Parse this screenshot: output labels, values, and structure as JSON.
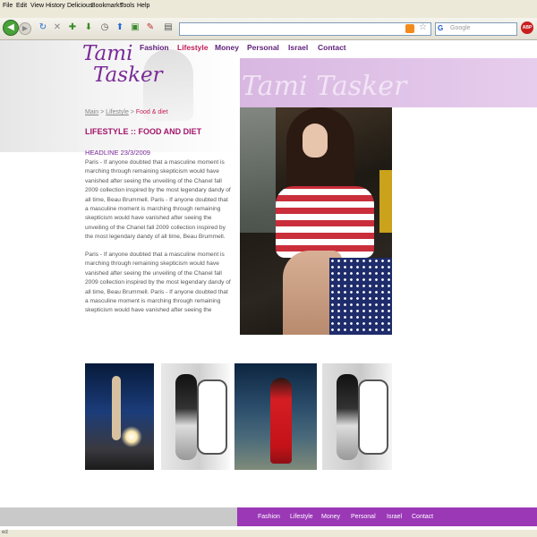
{
  "browser": {
    "menu": [
      "File",
      "Edit",
      "View",
      "History",
      "Delicious",
      "Bookmarks",
      "Tools",
      "Help"
    ],
    "search_placeholder": "Google",
    "adblock_label": "ABP",
    "status_text": "ed"
  },
  "site": {
    "logo_line1": "Tami",
    "logo_line2": "Tasker",
    "banner_watermark": "Tami Tasker",
    "nav": [
      "Fashion",
      "Lifestyle",
      "Money",
      "Personal",
      "Israel",
      "Contact"
    ],
    "active_nav": "Lifestyle"
  },
  "content": {
    "breadcrumb": {
      "main": "Main",
      "sep1": " > ",
      "lifestyle": "Lifestyle",
      "sep2": " > ",
      "current": "Food & diet"
    },
    "section_title": "LIFESTYLE :: FOOD AND DIET",
    "headline": "HEADLINE 23/3/2009",
    "paragraph1": "Paris - If anyone doubted that a masculine moment is marching through remaining skepticism would have vanished after seeing the unveiling of the Chanel fall 2009 collection inspired by the most legendary dandy of all time, Beau Brummell. Paris - If anyone doubted that a masculine moment is marching through remaining skepticism would have vanished after seeing the unveiling of the Chanel fall 2009 collection inspired by the most legendary dandy of all time, Beau Brummell.",
    "paragraph2": "Paris - If anyone doubted that a masculine moment is marching through remaining skepticism would have vanished after seeing the unveiling of the Chanel fall 2009 collection inspired by the most legendary dandy of all time, Beau Brummell. Paris - If anyone doubted that a masculine moment is marching through remaining skepticism would have vanished after seeing the"
  },
  "footer": {
    "nav": [
      "Fashion",
      "Lifestyle",
      "Money",
      "Personal",
      "Israel",
      "Contact"
    ]
  },
  "colors": {
    "accent_purple": "#9a38b6",
    "nav_purple": "#5e1f7a",
    "active_red": "#c41e59",
    "title_magenta": "#a3156b"
  }
}
